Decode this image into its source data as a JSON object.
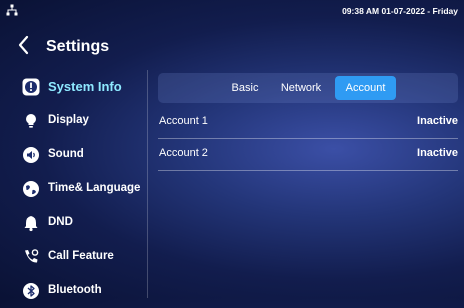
{
  "status_bar": {
    "datetime": "09:38 AM  01-07-2022 - Friday"
  },
  "header": {
    "title": "Settings"
  },
  "sidebar": {
    "items": [
      {
        "label": "System Info",
        "icon": "info-icon",
        "active": true
      },
      {
        "label": "Display",
        "icon": "bulb-icon"
      },
      {
        "label": "Sound",
        "icon": "speaker-icon"
      },
      {
        "label": "Time& Language",
        "icon": "globe-icon"
      },
      {
        "label": "DND",
        "icon": "bell-icon"
      },
      {
        "label": "Call Feature",
        "icon": "phone-settings-icon"
      },
      {
        "label": "Bluetooth",
        "icon": "bluetooth-icon"
      }
    ]
  },
  "tabs": [
    {
      "label": "Basic"
    },
    {
      "label": "Network"
    },
    {
      "label": "Account",
      "active": true
    }
  ],
  "accounts": [
    {
      "name": "Account 1",
      "status": "Inactive"
    },
    {
      "name": "Account 2",
      "status": "Inactive"
    }
  ],
  "colors": {
    "accent": "#2f9bf3",
    "active_text": "#8ee9ff",
    "background": "#1a2a66"
  }
}
